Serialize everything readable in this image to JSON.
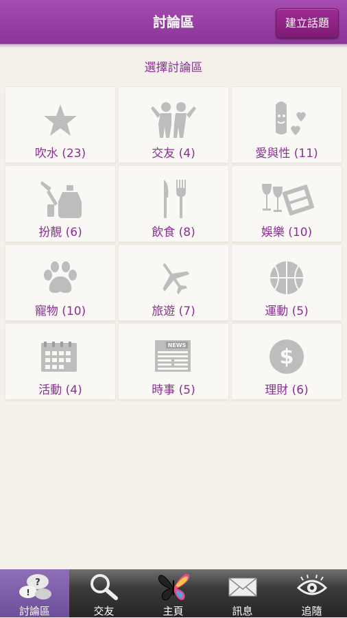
{
  "header": {
    "title": "討論區",
    "new_topic_label": "建立話題"
  },
  "section_label": "選擇討論區",
  "categories": [
    {
      "label": "吹水 (23)",
      "icon": "star-icon"
    },
    {
      "label": "交友 (4)",
      "icon": "friends-icon"
    },
    {
      "label": "愛與性 (11)",
      "icon": "love-sex-icon"
    },
    {
      "label": "扮靚 (6)",
      "icon": "makeup-icon"
    },
    {
      "label": "飲食 (8)",
      "icon": "fork-knife-icon"
    },
    {
      "label": "娛樂 (10)",
      "icon": "wine-film-icon"
    },
    {
      "label": "寵物 (10)",
      "icon": "paw-icon"
    },
    {
      "label": "旅遊 (7)",
      "icon": "airplane-icon"
    },
    {
      "label": "運動 (5)",
      "icon": "basketball-icon"
    },
    {
      "label": "活動 (4)",
      "icon": "calendar-icon"
    },
    {
      "label": "時事 (5)",
      "icon": "newspaper-icon"
    },
    {
      "label": "理財 (6)",
      "icon": "dollar-icon"
    }
  ],
  "news_badge": "NEWS",
  "tabs": [
    {
      "label": "討論區",
      "icon": "forum-icon",
      "active": true
    },
    {
      "label": "交友",
      "icon": "search-icon",
      "active": false
    },
    {
      "label": "主頁",
      "icon": "butterfly-icon",
      "active": false
    },
    {
      "label": "訊息",
      "icon": "envelope-icon",
      "active": false
    },
    {
      "label": "追隨",
      "icon": "eye-icon",
      "active": false
    }
  ],
  "colors": {
    "header": "#9a40a6",
    "accent_text": "#8a2f94",
    "icon_grey": "#bdbdbd",
    "background": "#f3f1e9"
  }
}
